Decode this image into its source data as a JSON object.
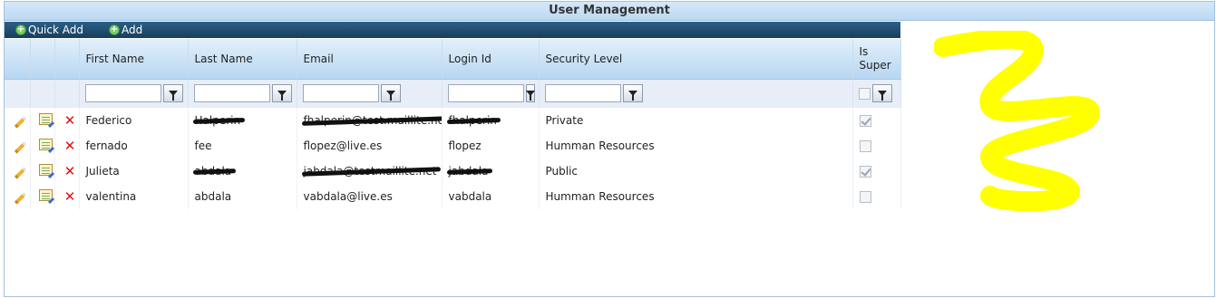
{
  "window": {
    "title": "User Management"
  },
  "toolbar": {
    "quick_add_label": "Quick Add",
    "add_label": "Add"
  },
  "columns": {
    "first_name": "First Name",
    "last_name": "Last Name",
    "email": "Email",
    "login_id": "Login Id",
    "security_level": "Security Level",
    "is_super": "Is Super"
  },
  "rows": [
    {
      "first_name": "Federico",
      "last_name": "Halperin",
      "email": "fhalperin@test.maillite.net",
      "login_id": "fhalperin",
      "security_level": "Private",
      "is_super": true,
      "redacted": [
        "last_name",
        "email",
        "login_id"
      ]
    },
    {
      "first_name": "fernado",
      "last_name": "fee",
      "email": "flopez@live.es",
      "login_id": "flopez",
      "security_level": "Humman Resources",
      "is_super": false,
      "redacted": []
    },
    {
      "first_name": "Julieta",
      "last_name": "abdala",
      "email": "jabdala@testmaillite.net",
      "login_id": "jabdala",
      "security_level": "Public",
      "is_super": true,
      "redacted": [
        "last_name",
        "email",
        "login_id"
      ]
    },
    {
      "first_name": "valentina",
      "last_name": "abdala",
      "email": "vabdala@live.es",
      "login_id": "vabdala",
      "security_level": "Humman Resources",
      "is_super": false,
      "redacted": []
    }
  ],
  "colors": {
    "toolbar": "#1f4a6c",
    "header_gradient_end": "#b7d6f1",
    "highlight": "#ffff00",
    "delete": "#e01010"
  }
}
